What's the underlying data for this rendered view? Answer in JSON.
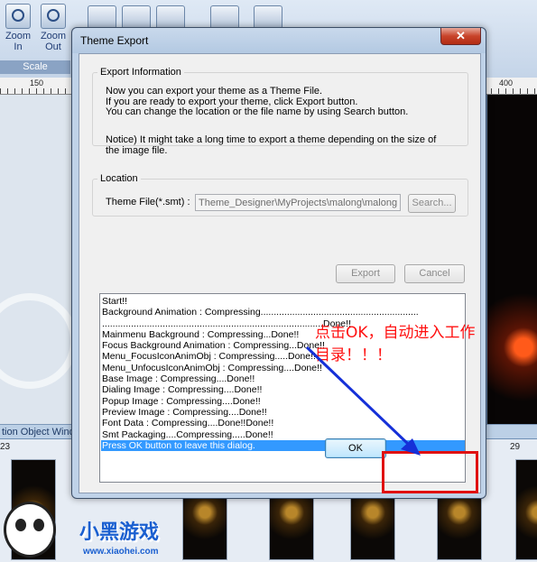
{
  "app": {
    "toolbar": {
      "zoom_in": "Zoom\nIn",
      "zoom_out": "Zoom\nOut",
      "group_label": "Scale"
    },
    "ruler": {
      "tick_150": "150",
      "tick_400": "400"
    },
    "panel_title": "tion Object Wind",
    "frames": {
      "first_number": "23",
      "last_number": "29"
    },
    "watermark": {
      "logo_text": "小黑游戏",
      "url": "www.xiaohei.com"
    }
  },
  "dialog": {
    "title": "Theme Export",
    "close_glyph": "✕",
    "export_info": {
      "legend": "Export Information",
      "text": "Now you can export your theme as a Theme File.\nIf you are ready to export your theme, click Export button.\nYou can change the location or the file name by using Search button.",
      "notice": "Notice) It might take a long time to export a theme depending on the size of the image file."
    },
    "location": {
      "legend": "Location",
      "field_label": "Theme File(*.smt) :",
      "path_value": "Theme_Designer\\MyProjects\\malong\\malong.smt",
      "search_label": "Search..."
    },
    "export_label": "Export",
    "cancel_label": "Cancel",
    "log": [
      "Start!!",
      "Background Animation : Compressing............................................................",
      "....................................................................................Done!!",
      "Mainmenu Background : Compressing...Done!!",
      "Focus Background Animation : Compressing...Done!!",
      "Menu_FocusIconAnimObj : Compressing.....Done!!",
      "Menu_UnfocusIconAnimObj : Compressing....Done!!",
      "Base Image : Compressing....Done!!",
      "Dialing Image : Compressing....Done!!",
      "Popup Image : Compressing....Done!!",
      "Preview Image : Compressing....Done!!",
      "Font Data : Compressing....Done!!Done!!",
      "Smt Packaging....Compressing.....Done!!",
      "Press OK button to leave this dialog."
    ],
    "ok_label": "OK"
  },
  "annotation": {
    "text": "点击OK，自动进入工作目录！！！",
    "color": "#ff1010",
    "arrow_color": "#1530d8"
  }
}
